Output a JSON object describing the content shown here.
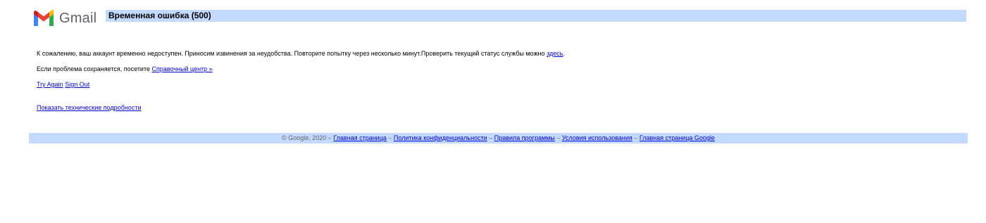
{
  "header": {
    "logo_text": "Gmail",
    "title": "Временная ошибка (500)"
  },
  "message": {
    "text": "К сожалению, ваш аккаунт временно недоступен. Приносим извинения за неудобства. Повторите попытку через несколько минут.Проверить текущий статус службы можно ",
    "status_link": "здесь",
    "text_end": "."
  },
  "help": {
    "text": "Если проблема сохраняется, посетите ",
    "help_center_link": "Справочный центр »"
  },
  "actions": {
    "try_again": "Try Again",
    "sign_out": "Sign Out"
  },
  "details": {
    "link": "Показать технические подробности"
  },
  "footer": {
    "copyright": "© Google, 2020",
    "separator": "–",
    "links": [
      "Главная страница",
      "Политика конфиденциальности",
      "Правила программы",
      "Условия использования",
      "Главная страница Google"
    ]
  },
  "colors": {
    "bar_background": "#c3d9ff",
    "link": "#0000cc",
    "logo_text": "#5f6368"
  },
  "icons": {
    "logo": "gmail-logo-icon"
  }
}
